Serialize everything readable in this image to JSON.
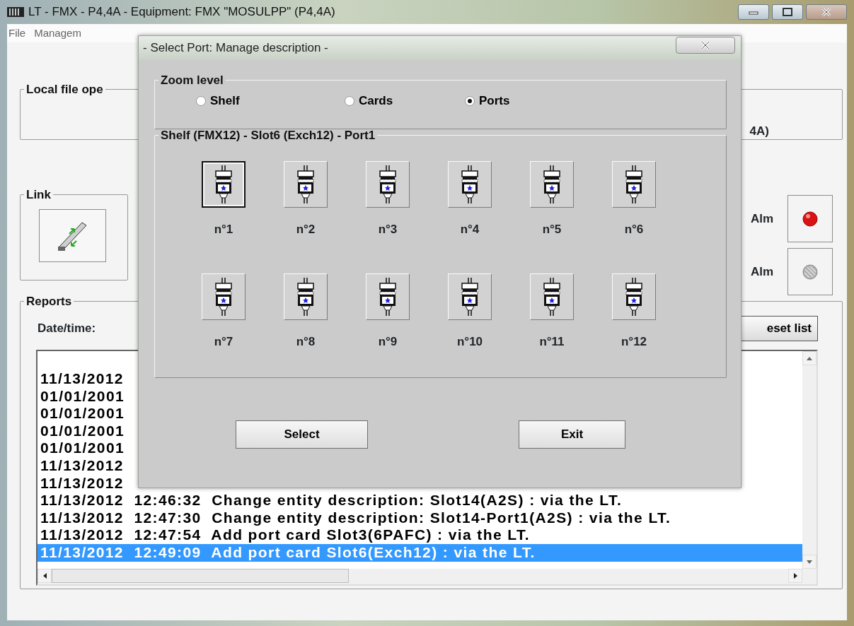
{
  "window": {
    "title": "LT - FMX - P4,4A - Equipment: FMX \"MOSULPP\" (P4,4A)"
  },
  "menu": [
    {
      "label": "File"
    },
    {
      "label": "Managem"
    }
  ],
  "local_file_group": {
    "title": "Local file ope",
    "text": "4A)"
  },
  "link_group": {
    "title": "Link"
  },
  "alarms": [
    {
      "label": "Alm",
      "active": true
    },
    {
      "label": "Alm",
      "active": false
    }
  ],
  "reports": {
    "title": "Reports",
    "date_label": "Date/time:",
    "reset_button": "eset list",
    "rows": [
      {
        "text": "11/13/2012",
        "selected": false
      },
      {
        "text": "01/01/2001",
        "selected": false
      },
      {
        "text": "01/01/2001",
        "selected": false
      },
      {
        "text": "01/01/2001",
        "selected": false
      },
      {
        "text": "01/01/2001",
        "selected": false
      },
      {
        "text": "11/13/2012",
        "selected": false
      },
      {
        "text": "11/13/2012",
        "selected": false
      },
      {
        "text": "11/13/2012  12:46:32  Change entity description: Slot14(A2S) : via the LT.",
        "selected": false
      },
      {
        "text": "11/13/2012  12:47:30  Change entity description: Slot14-Port1(A2S) : via the LT.",
        "selected": false
      },
      {
        "text": "11/13/2012  12:47:54  Add port card Slot3(6PAFC) : via the LT.",
        "selected": false
      },
      {
        "text": "11/13/2012  12:49:09  Add port card Slot6(Exch12) : via the LT.",
        "selected": true
      }
    ]
  },
  "dialog": {
    "title": "- Select Port: Manage description -",
    "zoom_group": {
      "title": "Zoom level",
      "options": [
        {
          "label": "Shelf",
          "selected": false
        },
        {
          "label": "Cards",
          "selected": false
        },
        {
          "label": "Ports",
          "selected": true
        }
      ]
    },
    "port_group": {
      "title": "Shelf (FMX12) - Slot6 (Exch12) - Port1",
      "ports": [
        {
          "label": "n°1",
          "selected": true
        },
        {
          "label": "n°2",
          "selected": false
        },
        {
          "label": "n°3",
          "selected": false
        },
        {
          "label": "n°4",
          "selected": false
        },
        {
          "label": "n°5",
          "selected": false
        },
        {
          "label": "n°6",
          "selected": false
        },
        {
          "label": "n°7",
          "selected": false
        },
        {
          "label": "n°8",
          "selected": false
        },
        {
          "label": "n°9",
          "selected": false
        },
        {
          "label": "n°10",
          "selected": false
        },
        {
          "label": "n°11",
          "selected": false
        },
        {
          "label": "n°12",
          "selected": false
        }
      ]
    },
    "buttons": [
      "Select",
      "Exit"
    ]
  }
}
